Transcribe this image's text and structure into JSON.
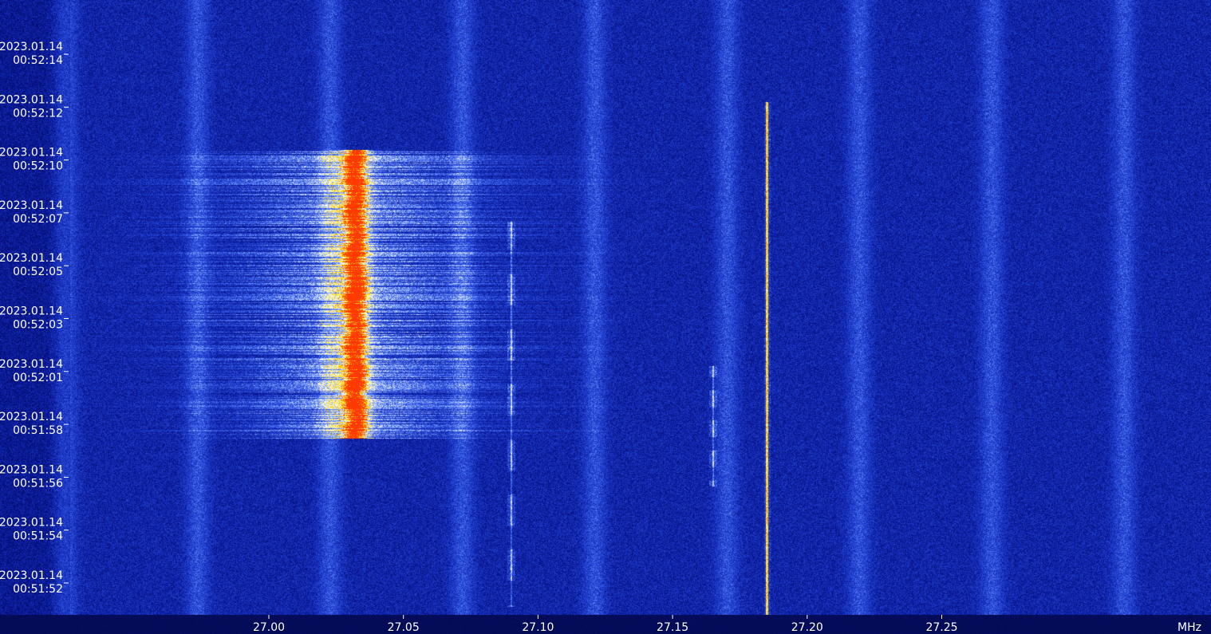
{
  "chart_data": {
    "type": "heatmap",
    "title": "",
    "x_unit": "MHz",
    "x_ticks": [
      27.0,
      27.05,
      27.1,
      27.15,
      27.2,
      27.25
    ],
    "x_tick_labels": [
      "27.00",
      "27.05",
      "27.10",
      "27.15",
      "27.20",
      "27.25"
    ],
    "xlim": [
      26.925,
      27.345
    ],
    "time_ticks": [
      {
        "date": "2023.01.14",
        "time": "00:52:14"
      },
      {
        "date": "2023.01.14",
        "time": "00:52:12"
      },
      {
        "date": "2023.01.14",
        "time": "00:52:10"
      },
      {
        "date": "2023.01.14",
        "time": "00:52:07"
      },
      {
        "date": "2023.01.14",
        "time": "00:52:05"
      },
      {
        "date": "2023.01.14",
        "time": "00:52:03"
      },
      {
        "date": "2023.01.14",
        "time": "00:52:01"
      },
      {
        "date": "2023.01.14",
        "time": "00:51:58"
      },
      {
        "date": "2023.01.14",
        "time": "00:51:56"
      },
      {
        "date": "2023.01.14",
        "time": "00:51:54"
      },
      {
        "date": "2023.01.14",
        "time": "00:51:52"
      }
    ],
    "colormap": [
      "#000550",
      "#0a1a9c",
      "#2b4fe0",
      "#8fb0ff",
      "#ffffff",
      "#ffe600",
      "#ff3a00"
    ],
    "signals": [
      {
        "label": "",
        "freq_mhz": 27.032,
        "kind": "wideband-burst",
        "start_time": "00:51:58",
        "end_time": "00:52:10"
      },
      {
        "label": "",
        "freq_mhz": 27.185,
        "kind": "carrier",
        "start_time": "00:51:51",
        "end_time": "00:52:12"
      },
      {
        "label": "",
        "freq_mhz": 27.09,
        "kind": "intermittent",
        "start_time": "00:51:51",
        "end_time": "00:52:07"
      },
      {
        "label": "",
        "freq_mhz": 27.165,
        "kind": "intermittent",
        "start_time": "00:51:56",
        "end_time": "00:52:01"
      }
    ]
  }
}
